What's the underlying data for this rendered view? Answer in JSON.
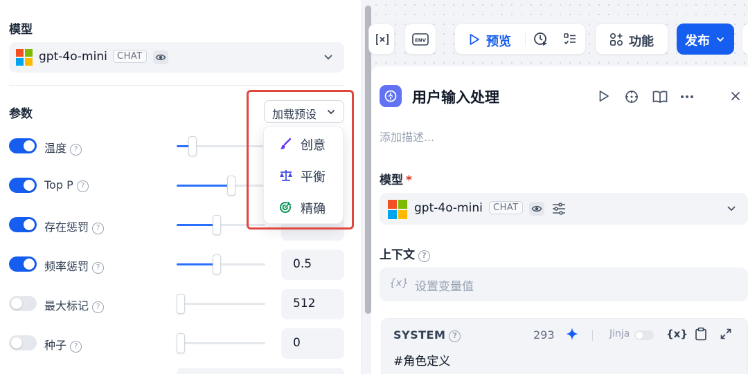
{
  "left_panel": {
    "model_title": "模型",
    "model": {
      "name": "gpt-4o-mini",
      "badge": "CHAT"
    },
    "params_title": "参数",
    "preset_button": "加载预设",
    "presets": [
      {
        "label": "创意",
        "icon": "brush-icon",
        "color": "#6938ef"
      },
      {
        "label": "平衡",
        "icon": "scales-icon",
        "color": "#444ce7"
      },
      {
        "label": "精确",
        "icon": "target-icon",
        "color": "#079455"
      }
    ],
    "params": [
      {
        "label": "温度",
        "enabled": true,
        "level": 0.18
      },
      {
        "label": "Top P",
        "enabled": true,
        "level": 0.62
      },
      {
        "label": "存在惩罚",
        "enabled": true,
        "level": 0.45
      },
      {
        "label": "频率惩罚",
        "enabled": true,
        "level": 0.45,
        "value": "0.5"
      },
      {
        "label": "最大标记",
        "enabled": false,
        "level": 0.04,
        "value": "512"
      },
      {
        "label": "种子",
        "enabled": false,
        "level": 0.0,
        "value": "0"
      }
    ]
  },
  "toolbar": {
    "preview": "预览",
    "features": "功能",
    "publish": "发布",
    "env_icon_text": "ENV"
  },
  "node": {
    "title": "用户输入处理",
    "description_placeholder": "添加描述...",
    "model_label": "模型",
    "required_mark": "*",
    "model": {
      "name": "gpt-4o-mini",
      "badge": "CHAT"
    },
    "context_label": "上下文",
    "context_var_icon": "{x}",
    "context_placeholder": "设置变量值",
    "system": {
      "label": "SYSTEM",
      "count": "293",
      "jinja_label": "Jinja",
      "var_icon": "{x}",
      "text": "#角色定义"
    }
  },
  "colors": {
    "accent": "#155eef",
    "highlight": "#e0473f",
    "node_icon": "#6172f3"
  }
}
